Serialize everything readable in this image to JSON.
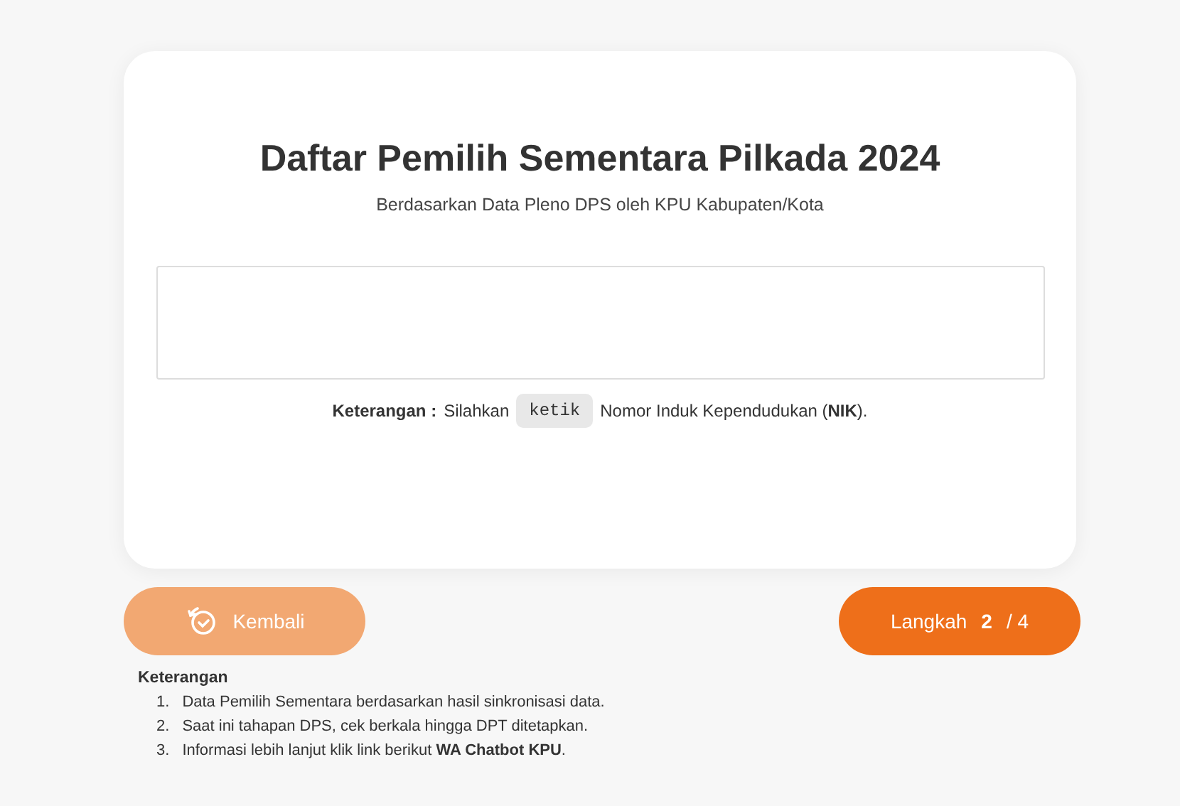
{
  "card": {
    "title": "Daftar Pemilih Sementara Pilkada 2024",
    "subtitle": "Berdasarkan Data Pleno DPS oleh KPU Kabupaten/Kota",
    "hint": {
      "label": "Keterangan :",
      "before": "Silahkan",
      "code": "ketik",
      "after": "Nomor Induk Kependudukan (**NIK**)."
    }
  },
  "back_button": {
    "label": "Kembali",
    "disabled": true
  },
  "step_button": {
    "label": "Langkah **2** / 4"
  },
  "notes": {
    "title": "Keterangan",
    "items": [
      {
        "number": "1.",
        "text": "Data Pemilih Sementara berdasarkan hasil sinkronisasi data."
      },
      {
        "number": "2.",
        "text": "Saat ini tahapan DPS, cek berkala hingga DPT ditetapkan."
      },
      {
        "number": "3.",
        "text": "Informasi lebih lanjut klik link berikut **WA Chatbot KPU**."
      }
    ]
  }
}
